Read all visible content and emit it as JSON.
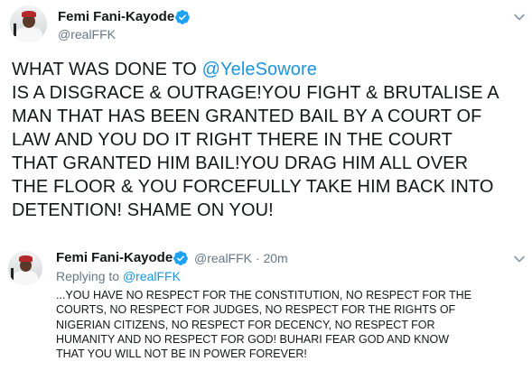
{
  "main_tweet": {
    "author_name": "Femi Fani-Kayode",
    "author_handle": "@realFFK",
    "text_lines": [
      {
        "before": "WHAT WAS DONE TO ",
        "mention": "@YeleSowore",
        "after": ""
      },
      {
        "before": "IS A DISGRACE & OUTRAGE!YOU FIGHT & BRUTALISE A",
        "mention": "",
        "after": ""
      },
      {
        "before": "MAN THAT HAS BEEN GRANTED BAIL BY A COURT OF",
        "mention": "",
        "after": ""
      },
      {
        "before": "LAW AND YOU DO IT RIGHT THERE IN THE COURT",
        "mention": "",
        "after": ""
      },
      {
        "before": "THAT GRANTED HIM BAIL!YOU DRAG HIM ALL OVER",
        "mention": "",
        "after": ""
      },
      {
        "before": "THE FLOOR & YOU FORCEFULLY TAKE HIM BACK INTO",
        "mention": "",
        "after": ""
      },
      {
        "before": "DETENTION! SHAME ON YOU!",
        "mention": "",
        "after": ""
      }
    ]
  },
  "reply_tweet": {
    "author_name": "Femi Fani-Kayode",
    "author_handle": "@realFFK",
    "separator": "·",
    "time": "20m",
    "replying_prefix": "Replying to ",
    "replying_handle": "@realFFK",
    "text_lines": [
      "...YOU HAVE NO RESPECT FOR THE CONSTITUTION, NO RESPECT FOR THE",
      "COURTS, NO RESPECT FOR JUDGES, NO RESPECT FOR THE RIGHTS OF",
      "NIGERIAN CITIZENS, NO RESPECT FOR DECENCY, NO RESPECT FOR",
      "HUMANITY AND NO RESPECT FOR GOD! BUHARI FEAR GOD AND KNOW",
      "THAT YOU WILL NOT BE IN POWER FOREVER!"
    ]
  },
  "icons": {
    "verified": "verified-badge-icon",
    "more": "chevron-down-icon"
  },
  "colors": {
    "link": "#1b95e0",
    "secondary_text": "#657786",
    "primary_text": "#14171a"
  }
}
